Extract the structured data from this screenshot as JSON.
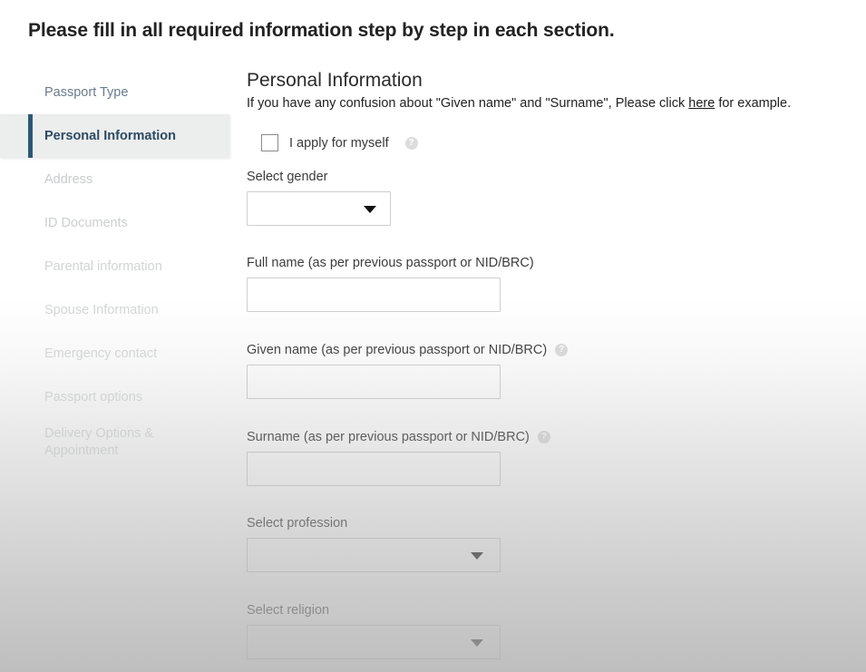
{
  "page": {
    "title": "Please fill in all required information step by step in each section."
  },
  "sidebar": {
    "items": [
      {
        "label": "Passport Type",
        "state": "first"
      },
      {
        "label": "Personal Information",
        "state": "active"
      },
      {
        "label": "Address",
        "state": "dim1"
      },
      {
        "label": "ID Documents",
        "state": "dim2"
      },
      {
        "label": "Parental information",
        "state": "dim3"
      },
      {
        "label": "Spouse Information",
        "state": "dim4"
      },
      {
        "label": "Emergency contact",
        "state": "dim5"
      },
      {
        "label": "Passport options",
        "state": "dim6"
      },
      {
        "label": "Delivery Options &\nAppointment",
        "state": "dim7"
      }
    ]
  },
  "form": {
    "section_title": "Personal Information",
    "note_prefix": "If you have any confusion about \"Given name\" and \"Surname\", Please click ",
    "note_link": "here",
    "note_suffix": " for example.",
    "self_apply": {
      "label": "I apply for myself",
      "checked": false,
      "help_icon": "question-circle-icon"
    },
    "gender": {
      "label": "Select gender",
      "value": "",
      "arrow_icon": "caret-down-icon"
    },
    "full_name": {
      "label": "Full name (as per previous passport or NID/BRC)",
      "value": "",
      "placeholder": ""
    },
    "given_name": {
      "label": "Given name (as per previous passport or NID/BRC)",
      "value": "",
      "placeholder": "",
      "help_icon": "question-circle-icon"
    },
    "surname": {
      "label": "Surname (as per previous passport or NID/BRC)",
      "value": "",
      "placeholder": "",
      "help_icon": "question-circle-icon"
    },
    "profession": {
      "label": "Select profession",
      "value": "",
      "arrow_icon": "caret-down-icon"
    },
    "religion": {
      "label": "Select religion",
      "value": "",
      "arrow_icon": "caret-down-icon"
    }
  },
  "colors": {
    "accent": "#2c5871",
    "active_text": "#2c4a63",
    "active_bg": "#eceded",
    "first_item_text": "#6b7b8c",
    "heading": "#222222",
    "body_text": "#3c3c3c",
    "input_border": "#cfcfcf"
  }
}
